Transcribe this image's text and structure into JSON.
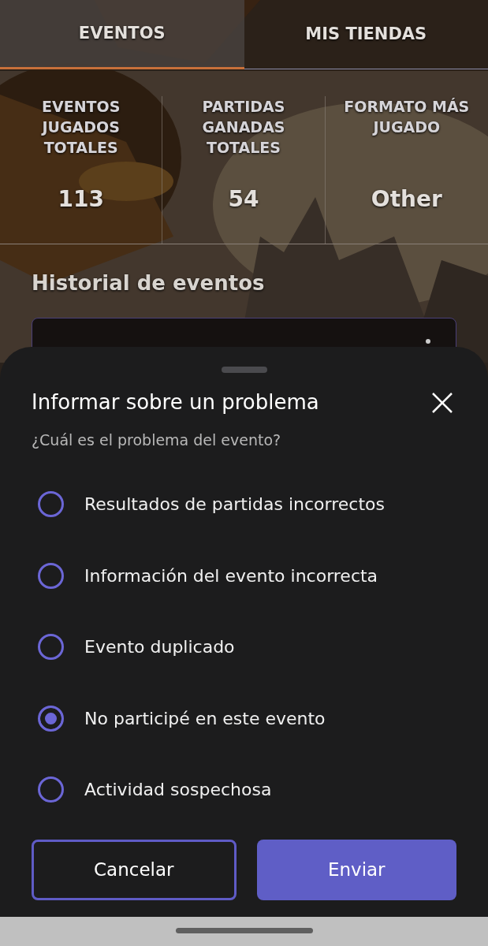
{
  "tabs": [
    {
      "label": "EVENTOS",
      "selected": true
    },
    {
      "label": "MIS TIENDAS",
      "selected": false
    }
  ],
  "stats": [
    {
      "label": "EVENTOS JUGADOS TOTALES",
      "value": "113"
    },
    {
      "label": "PARTIDAS GANADAS TOTALES",
      "value": "54"
    },
    {
      "label": "FORMATO MÁS JUGADO",
      "value": "Other"
    }
  ],
  "section_title": "Historial de eventos",
  "sheet": {
    "title": "Informar sobre un problema",
    "question": "¿Cuál es el problema del evento?",
    "options": [
      {
        "label": "Resultados de partidas incorrectos",
        "selected": false
      },
      {
        "label": "Información del evento incorrecta",
        "selected": false
      },
      {
        "label": "Evento duplicado",
        "selected": false
      },
      {
        "label": "No participé en este evento",
        "selected": true
      },
      {
        "label": "Actividad sospechosa",
        "selected": false
      }
    ],
    "buttons": [
      {
        "label": "Cancelar",
        "kind": "outline"
      },
      {
        "label": "Enviar",
        "kind": "primary"
      }
    ]
  }
}
